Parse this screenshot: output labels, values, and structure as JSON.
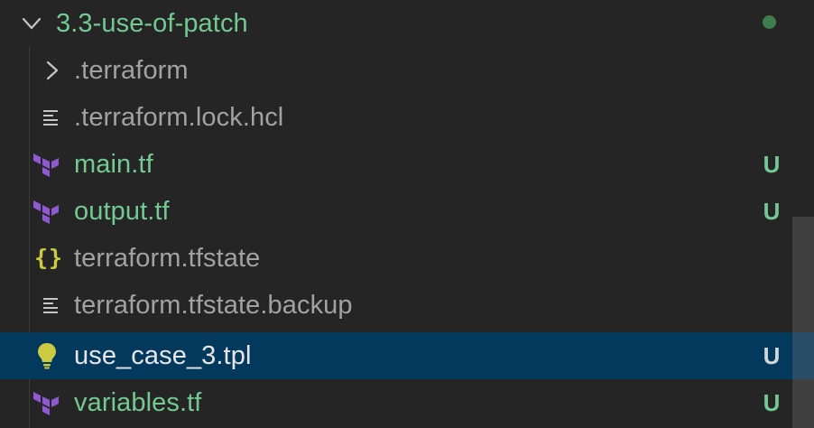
{
  "folder": {
    "name": "3.3-use-of-patch",
    "expanded": true,
    "status_color": "#3f7d4f"
  },
  "items": [
    {
      "type": "folder",
      "name": ".terraform",
      "icon": "chevron-right-icon",
      "status": ""
    },
    {
      "type": "file",
      "name": ".terraform.lock.hcl",
      "icon": "text-lines-icon",
      "status": ""
    },
    {
      "type": "file",
      "name": "main.tf",
      "icon": "terraform-icon",
      "status": "U"
    },
    {
      "type": "file",
      "name": "output.tf",
      "icon": "terraform-icon",
      "status": "U"
    },
    {
      "type": "file",
      "name": "terraform.tfstate",
      "icon": "json-braces-icon",
      "status": ""
    },
    {
      "type": "file",
      "name": "terraform.tfstate.backup",
      "icon": "text-lines-icon",
      "status": ""
    },
    {
      "type": "file",
      "name": "use_case_3.tpl",
      "icon": "lightbulb-icon",
      "status": "U",
      "selected": true
    },
    {
      "type": "file",
      "name": "variables.tf",
      "icon": "terraform-icon",
      "status": "U"
    }
  ],
  "colors": {
    "background": "#252526",
    "selection": "#04395e",
    "untracked": "#73c991",
    "dim_text": "#a2a2a2",
    "terraform_purple": "#8f59d1",
    "json_yellow": "#cbcb41"
  }
}
